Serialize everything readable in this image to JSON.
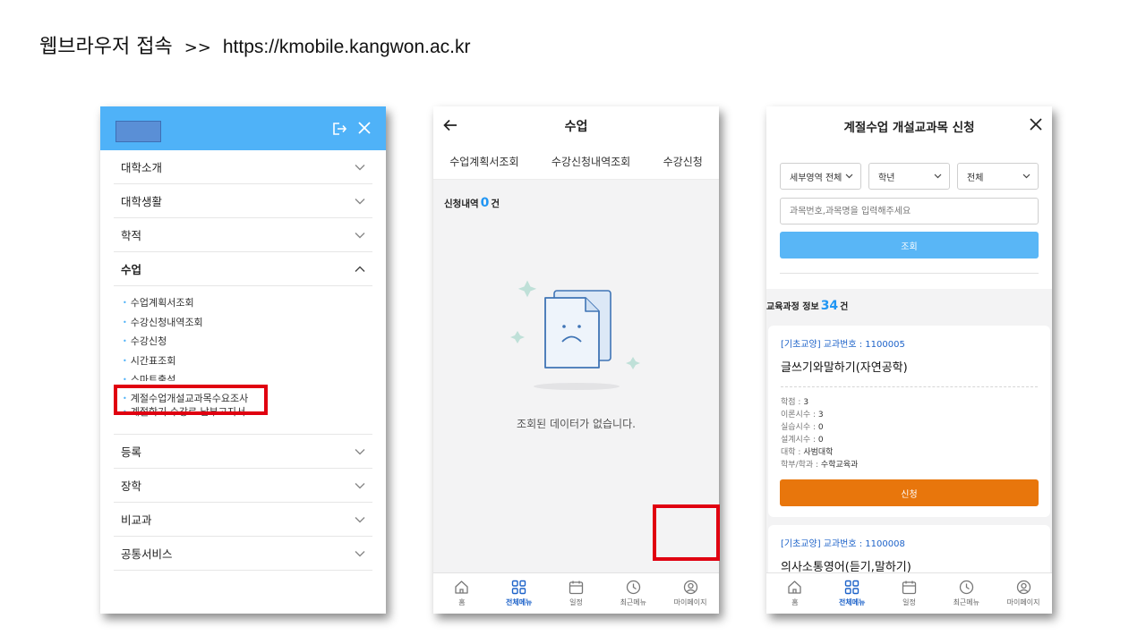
{
  "slide": {
    "title_kor": "웹브라우저 접속",
    "title_sep": ">>",
    "title_url": "https://kmobile.kangwon.ac.kr"
  },
  "colors": {
    "sky_blue": "#4fb2f8",
    "blue_text": "#1e63c9",
    "fab_blue": "#1e88e5",
    "orange": "#e8760c",
    "highlight_red": "#e00010"
  },
  "phone1": {
    "icons": [
      "logout-icon",
      "close-icon",
      "chevron-down-icon",
      "chevron-up-icon"
    ],
    "menu": [
      {
        "label": "대학소개"
      },
      {
        "label": "대학생활"
      },
      {
        "label": "학적"
      },
      {
        "label": "수업"
      },
      {
        "label": "등록"
      },
      {
        "label": "장학"
      },
      {
        "label": "비교과"
      },
      {
        "label": "공통서비스"
      }
    ],
    "submenu": [
      "수업계획서조회",
      "수강신청내역조회",
      "수강신청",
      "시간표조회",
      "스마트출석",
      "계절수업개설교과목수요조사",
      "계절학기 수강료 납부고지서"
    ]
  },
  "phone2": {
    "title": "수업",
    "tabs": [
      "수업계획서조회",
      "수강신청내역조회",
      "수강신청"
    ],
    "count_prefix": "신청내역",
    "count_value": "0",
    "count_suffix": "건",
    "empty_text": "조회된 데이터가 없습니다."
  },
  "bottom_nav": [
    "홈",
    "전체메뉴",
    "일정",
    "최근메뉴",
    "마이페이지"
  ],
  "phone3": {
    "title": "계절수업 개설교과목 신청",
    "filters": [
      "세부영역 전체",
      "학년",
      "전체"
    ],
    "search_placeholder": "과목번호,과목명을 입력해주세요",
    "search_button": "조회",
    "count_prefix": "교육과정 정보",
    "count_value": "34",
    "count_suffix": "건",
    "courses": [
      {
        "meta": "[기초교양] 교과번호 : 1100005",
        "name": "글쓰기와말하기(자연공학)",
        "details": [
          {
            "k": "학점 : ",
            "v": "3"
          },
          {
            "k": "이론시수 : ",
            "v": "3"
          },
          {
            "k": "실습시수 : ",
            "v": "0"
          },
          {
            "k": "설계시수 : ",
            "v": "0"
          },
          {
            "k": "대학 : ",
            "v": "사범대학"
          },
          {
            "k": "학부/학과 : ",
            "v": "수학교육과"
          }
        ],
        "apply_label": "신청"
      },
      {
        "meta": "[기초교양] 교과번호 : 1100008",
        "name": "의사소통영어(듣기,말하기)"
      }
    ]
  }
}
